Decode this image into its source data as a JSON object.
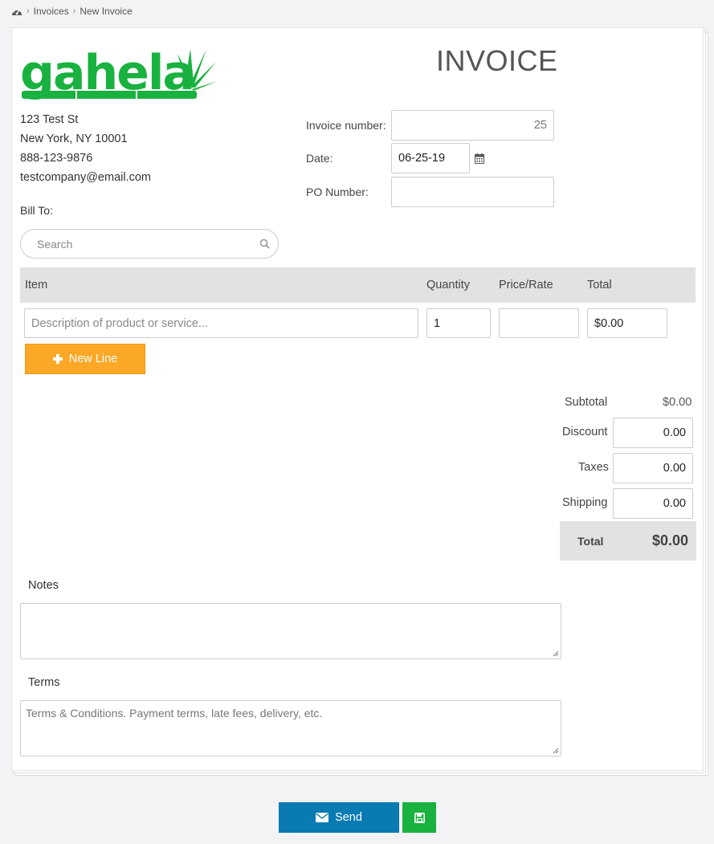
{
  "breadcrumb": {
    "home_icon": "dashboard-icon",
    "items": [
      "Invoices",
      "New Invoice"
    ]
  },
  "company": {
    "logo_text": "gahela",
    "address_line1": "123 Test St",
    "address_line2": "New York, NY 10001",
    "phone": "888-123-9876",
    "email": "testcompany@email.com"
  },
  "invoice": {
    "title": "INVOICE",
    "number_label": "Invoice number:",
    "number_value": "25",
    "date_label": "Date:",
    "date_value": "06-25-19",
    "po_label": "PO Number:",
    "po_value": ""
  },
  "bill_to": {
    "label": "Bill To:",
    "search_placeholder": "Search"
  },
  "items": {
    "headers": {
      "item": "Item",
      "quantity": "Quantity",
      "price": "Price/Rate",
      "total": "Total"
    },
    "row": {
      "description_placeholder": "Description of product or service...",
      "quantity": "1",
      "price": "",
      "total": "$0.00"
    },
    "new_line_label": "New Line"
  },
  "totals": {
    "subtotal_label": "Subtotal",
    "subtotal_value": "$0.00",
    "discount_label": "Discount",
    "discount_value": "0.00",
    "taxes_label": "Taxes",
    "taxes_value": "0.00",
    "shipping_label": "Shipping",
    "shipping_value": "0.00",
    "total_label": "Total",
    "total_value": "$0.00"
  },
  "notes": {
    "label": "Notes",
    "value": ""
  },
  "terms": {
    "label": "Terms",
    "placeholder": "Terms & Conditions.  Payment terms, late fees, delivery, etc."
  },
  "actions": {
    "send_label": "Send"
  },
  "colors": {
    "brand_green": "#19b13f",
    "accent_orange": "#fba826",
    "send_blue": "#0a7ab3"
  }
}
